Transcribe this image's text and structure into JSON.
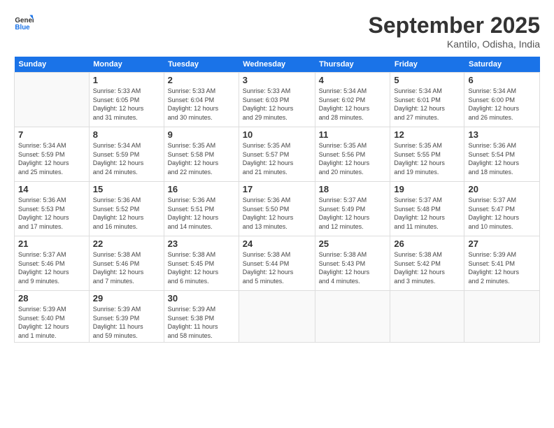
{
  "header": {
    "logo_line1": "General",
    "logo_line2": "Blue",
    "month": "September 2025",
    "location": "Kantilo, Odisha, India"
  },
  "weekdays": [
    "Sunday",
    "Monday",
    "Tuesday",
    "Wednesday",
    "Thursday",
    "Friday",
    "Saturday"
  ],
  "weeks": [
    [
      {
        "day": "",
        "info": ""
      },
      {
        "day": "1",
        "info": "Sunrise: 5:33 AM\nSunset: 6:05 PM\nDaylight: 12 hours\nand 31 minutes."
      },
      {
        "day": "2",
        "info": "Sunrise: 5:33 AM\nSunset: 6:04 PM\nDaylight: 12 hours\nand 30 minutes."
      },
      {
        "day": "3",
        "info": "Sunrise: 5:33 AM\nSunset: 6:03 PM\nDaylight: 12 hours\nand 29 minutes."
      },
      {
        "day": "4",
        "info": "Sunrise: 5:34 AM\nSunset: 6:02 PM\nDaylight: 12 hours\nand 28 minutes."
      },
      {
        "day": "5",
        "info": "Sunrise: 5:34 AM\nSunset: 6:01 PM\nDaylight: 12 hours\nand 27 minutes."
      },
      {
        "day": "6",
        "info": "Sunrise: 5:34 AM\nSunset: 6:00 PM\nDaylight: 12 hours\nand 26 minutes."
      }
    ],
    [
      {
        "day": "7",
        "info": "Sunrise: 5:34 AM\nSunset: 5:59 PM\nDaylight: 12 hours\nand 25 minutes."
      },
      {
        "day": "8",
        "info": "Sunrise: 5:34 AM\nSunset: 5:59 PM\nDaylight: 12 hours\nand 24 minutes."
      },
      {
        "day": "9",
        "info": "Sunrise: 5:35 AM\nSunset: 5:58 PM\nDaylight: 12 hours\nand 22 minutes."
      },
      {
        "day": "10",
        "info": "Sunrise: 5:35 AM\nSunset: 5:57 PM\nDaylight: 12 hours\nand 21 minutes."
      },
      {
        "day": "11",
        "info": "Sunrise: 5:35 AM\nSunset: 5:56 PM\nDaylight: 12 hours\nand 20 minutes."
      },
      {
        "day": "12",
        "info": "Sunrise: 5:35 AM\nSunset: 5:55 PM\nDaylight: 12 hours\nand 19 minutes."
      },
      {
        "day": "13",
        "info": "Sunrise: 5:36 AM\nSunset: 5:54 PM\nDaylight: 12 hours\nand 18 minutes."
      }
    ],
    [
      {
        "day": "14",
        "info": "Sunrise: 5:36 AM\nSunset: 5:53 PM\nDaylight: 12 hours\nand 17 minutes."
      },
      {
        "day": "15",
        "info": "Sunrise: 5:36 AM\nSunset: 5:52 PM\nDaylight: 12 hours\nand 16 minutes."
      },
      {
        "day": "16",
        "info": "Sunrise: 5:36 AM\nSunset: 5:51 PM\nDaylight: 12 hours\nand 14 minutes."
      },
      {
        "day": "17",
        "info": "Sunrise: 5:36 AM\nSunset: 5:50 PM\nDaylight: 12 hours\nand 13 minutes."
      },
      {
        "day": "18",
        "info": "Sunrise: 5:37 AM\nSunset: 5:49 PM\nDaylight: 12 hours\nand 12 minutes."
      },
      {
        "day": "19",
        "info": "Sunrise: 5:37 AM\nSunset: 5:48 PM\nDaylight: 12 hours\nand 11 minutes."
      },
      {
        "day": "20",
        "info": "Sunrise: 5:37 AM\nSunset: 5:47 PM\nDaylight: 12 hours\nand 10 minutes."
      }
    ],
    [
      {
        "day": "21",
        "info": "Sunrise: 5:37 AM\nSunset: 5:46 PM\nDaylight: 12 hours\nand 9 minutes."
      },
      {
        "day": "22",
        "info": "Sunrise: 5:38 AM\nSunset: 5:46 PM\nDaylight: 12 hours\nand 7 minutes."
      },
      {
        "day": "23",
        "info": "Sunrise: 5:38 AM\nSunset: 5:45 PM\nDaylight: 12 hours\nand 6 minutes."
      },
      {
        "day": "24",
        "info": "Sunrise: 5:38 AM\nSunset: 5:44 PM\nDaylight: 12 hours\nand 5 minutes."
      },
      {
        "day": "25",
        "info": "Sunrise: 5:38 AM\nSunset: 5:43 PM\nDaylight: 12 hours\nand 4 minutes."
      },
      {
        "day": "26",
        "info": "Sunrise: 5:38 AM\nSunset: 5:42 PM\nDaylight: 12 hours\nand 3 minutes."
      },
      {
        "day": "27",
        "info": "Sunrise: 5:39 AM\nSunset: 5:41 PM\nDaylight: 12 hours\nand 2 minutes."
      }
    ],
    [
      {
        "day": "28",
        "info": "Sunrise: 5:39 AM\nSunset: 5:40 PM\nDaylight: 12 hours\nand 1 minute."
      },
      {
        "day": "29",
        "info": "Sunrise: 5:39 AM\nSunset: 5:39 PM\nDaylight: 11 hours\nand 59 minutes."
      },
      {
        "day": "30",
        "info": "Sunrise: 5:39 AM\nSunset: 5:38 PM\nDaylight: 11 hours\nand 58 minutes."
      },
      {
        "day": "",
        "info": ""
      },
      {
        "day": "",
        "info": ""
      },
      {
        "day": "",
        "info": ""
      },
      {
        "day": "",
        "info": ""
      }
    ]
  ]
}
